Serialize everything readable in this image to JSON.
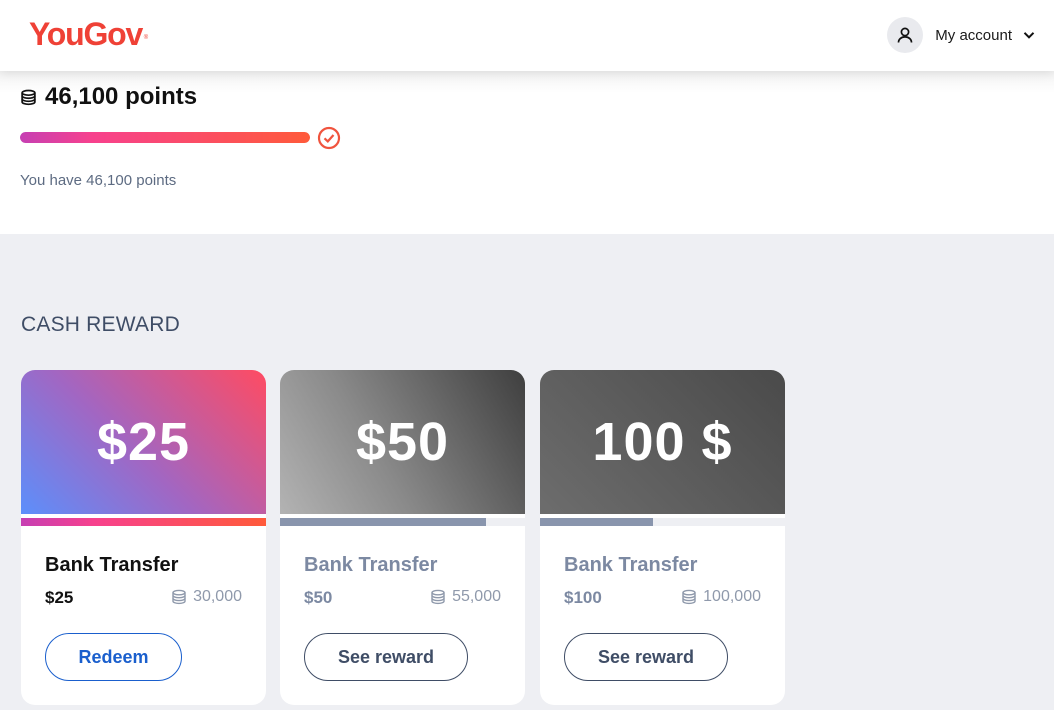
{
  "header": {
    "logo_text": "YouGov",
    "logo_mark": "®",
    "account_label": "My account",
    "account_icon": "user-icon",
    "dropdown_icon": "chevron-down-icon"
  },
  "points": {
    "balance_text": "46,100 points",
    "subtext": "You have 46,100 points",
    "progress_fraction": 1.0,
    "status_icon": "check-circle-icon"
  },
  "section": {
    "title": "CASH REWARD"
  },
  "rewards": [
    {
      "hero_amount": "$25",
      "title": "Bank Transfer",
      "price": "$25",
      "cost": "30,000",
      "button_label": "Redeem",
      "progress_fraction": 1.0,
      "state": "redeemable"
    },
    {
      "hero_amount": "$50",
      "title": "Bank Transfer",
      "price": "$50",
      "cost": "55,000",
      "button_label": "See reward",
      "progress_fraction": 0.84,
      "state": "locked"
    },
    {
      "hero_amount": "100 $",
      "title": "Bank Transfer",
      "price": "$100",
      "cost": "100,000",
      "button_label": "See reward",
      "progress_fraction": 0.46,
      "state": "locked"
    }
  ],
  "colors": {
    "brand": "#ef4136",
    "link_blue": "#1a5fcd",
    "muted_text": "#5d6b82",
    "locked_text": "#7c89a2",
    "section_background": "#eeeff3"
  }
}
